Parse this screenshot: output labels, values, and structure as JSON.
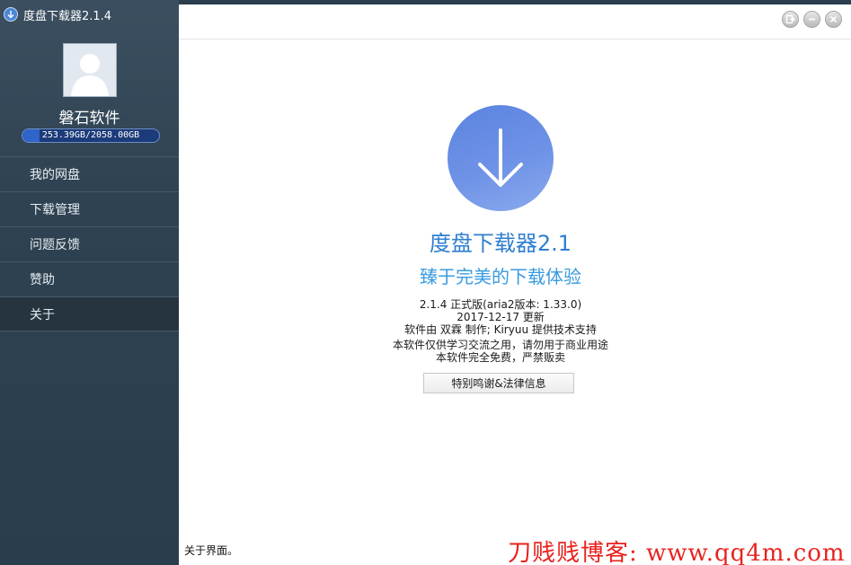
{
  "window": {
    "title": "度盘下载器2.1.4",
    "accent": "#2f7fd0"
  },
  "sidebar": {
    "username": "磐石软件",
    "quota_text": "253.39GB/2058.00GB",
    "quota_used_fraction": 0.123,
    "items": [
      {
        "label": "我的网盘"
      },
      {
        "label": "下载管理"
      },
      {
        "label": "问题反馈"
      },
      {
        "label": "赞助"
      },
      {
        "label": "关于"
      }
    ],
    "active_item": "关于"
  },
  "about": {
    "logo_icon": "download-arrow-icon",
    "product_name": "度盘下载器2.1",
    "slogan": "臻于完美的下载体验",
    "version_line": "2.1.4 正式版(aria2版本: 1.33.0)",
    "date_line": "2017-12-17 更新",
    "author_line": "软件由 双霖 制作; Kiryuu 提供技术支持",
    "notice_line1": "本软件仅供学习交流之用，请勿用于商业用途",
    "notice_line2": "本软件完全免费，严禁贩卖",
    "credits_button": "特别鸣谢&法律信息"
  },
  "status": {
    "text": "关于界面。"
  },
  "watermark": {
    "text": "刀贱贱博客: www.qq4m.com",
    "color": "#e8231f"
  }
}
